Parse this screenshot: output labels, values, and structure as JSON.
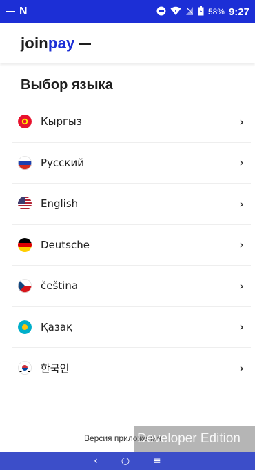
{
  "status_bar": {
    "battery_percent": "58%",
    "time": "9:27",
    "left_letter": "N"
  },
  "header": {
    "logo_part1": "join",
    "logo_part2": "pay"
  },
  "page": {
    "title": "Выбор языка"
  },
  "languages": [
    {
      "label": "Кыргыз",
      "flag": "kyrgyzstan-flag"
    },
    {
      "label": "Русский",
      "flag": "russia-flag"
    },
    {
      "label": "English",
      "flag": "usa-flag"
    },
    {
      "label": "Deutsche",
      "flag": "germany-flag"
    },
    {
      "label": "čeština",
      "flag": "czech-flag"
    },
    {
      "label": "Қазақ",
      "flag": "kazakhstan-flag"
    },
    {
      "label": "한국인",
      "flag": "korea-flag"
    }
  ],
  "chevron_glyph": "›",
  "footer": {
    "version_label": "Версия приложения",
    "watermark": "Developer Edition"
  },
  "nav": {
    "back": "‹",
    "home": "○",
    "recents": "≡"
  },
  "colors": {
    "status_bar_bg": "#1c2fd6",
    "brand_blue": "#1c2fd6",
    "nav_bar_bg": "#3c4ec9"
  }
}
